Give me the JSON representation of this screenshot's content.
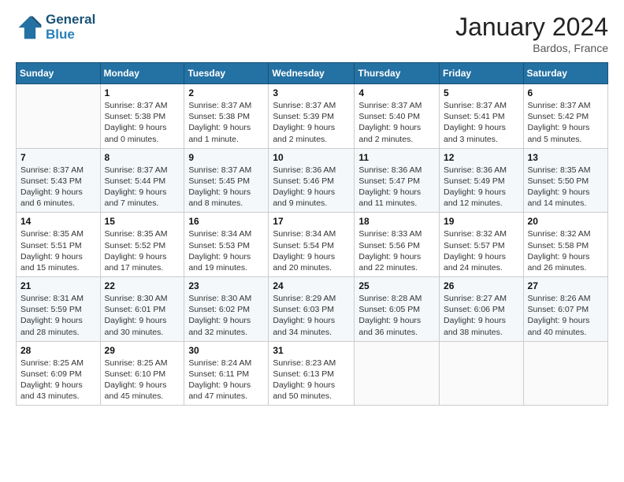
{
  "header": {
    "logo_line1": "General",
    "logo_line2": "Blue",
    "month_title": "January 2024",
    "location": "Bardos, France"
  },
  "weekdays": [
    "Sunday",
    "Monday",
    "Tuesday",
    "Wednesday",
    "Thursday",
    "Friday",
    "Saturday"
  ],
  "weeks": [
    [
      {
        "day": "",
        "sunrise": "",
        "sunset": "",
        "daylight": ""
      },
      {
        "day": "1",
        "sunrise": "Sunrise: 8:37 AM",
        "sunset": "Sunset: 5:38 PM",
        "daylight": "Daylight: 9 hours and 0 minutes."
      },
      {
        "day": "2",
        "sunrise": "Sunrise: 8:37 AM",
        "sunset": "Sunset: 5:38 PM",
        "daylight": "Daylight: 9 hours and 1 minute."
      },
      {
        "day": "3",
        "sunrise": "Sunrise: 8:37 AM",
        "sunset": "Sunset: 5:39 PM",
        "daylight": "Daylight: 9 hours and 2 minutes."
      },
      {
        "day": "4",
        "sunrise": "Sunrise: 8:37 AM",
        "sunset": "Sunset: 5:40 PM",
        "daylight": "Daylight: 9 hours and 2 minutes."
      },
      {
        "day": "5",
        "sunrise": "Sunrise: 8:37 AM",
        "sunset": "Sunset: 5:41 PM",
        "daylight": "Daylight: 9 hours and 3 minutes."
      },
      {
        "day": "6",
        "sunrise": "Sunrise: 8:37 AM",
        "sunset": "Sunset: 5:42 PM",
        "daylight": "Daylight: 9 hours and 5 minutes."
      }
    ],
    [
      {
        "day": "7",
        "sunrise": "Sunrise: 8:37 AM",
        "sunset": "Sunset: 5:43 PM",
        "daylight": "Daylight: 9 hours and 6 minutes."
      },
      {
        "day": "8",
        "sunrise": "Sunrise: 8:37 AM",
        "sunset": "Sunset: 5:44 PM",
        "daylight": "Daylight: 9 hours and 7 minutes."
      },
      {
        "day": "9",
        "sunrise": "Sunrise: 8:37 AM",
        "sunset": "Sunset: 5:45 PM",
        "daylight": "Daylight: 9 hours and 8 minutes."
      },
      {
        "day": "10",
        "sunrise": "Sunrise: 8:36 AM",
        "sunset": "Sunset: 5:46 PM",
        "daylight": "Daylight: 9 hours and 9 minutes."
      },
      {
        "day": "11",
        "sunrise": "Sunrise: 8:36 AM",
        "sunset": "Sunset: 5:47 PM",
        "daylight": "Daylight: 9 hours and 11 minutes."
      },
      {
        "day": "12",
        "sunrise": "Sunrise: 8:36 AM",
        "sunset": "Sunset: 5:49 PM",
        "daylight": "Daylight: 9 hours and 12 minutes."
      },
      {
        "day": "13",
        "sunrise": "Sunrise: 8:35 AM",
        "sunset": "Sunset: 5:50 PM",
        "daylight": "Daylight: 9 hours and 14 minutes."
      }
    ],
    [
      {
        "day": "14",
        "sunrise": "Sunrise: 8:35 AM",
        "sunset": "Sunset: 5:51 PM",
        "daylight": "Daylight: 9 hours and 15 minutes."
      },
      {
        "day": "15",
        "sunrise": "Sunrise: 8:35 AM",
        "sunset": "Sunset: 5:52 PM",
        "daylight": "Daylight: 9 hours and 17 minutes."
      },
      {
        "day": "16",
        "sunrise": "Sunrise: 8:34 AM",
        "sunset": "Sunset: 5:53 PM",
        "daylight": "Daylight: 9 hours and 19 minutes."
      },
      {
        "day": "17",
        "sunrise": "Sunrise: 8:34 AM",
        "sunset": "Sunset: 5:54 PM",
        "daylight": "Daylight: 9 hours and 20 minutes."
      },
      {
        "day": "18",
        "sunrise": "Sunrise: 8:33 AM",
        "sunset": "Sunset: 5:56 PM",
        "daylight": "Daylight: 9 hours and 22 minutes."
      },
      {
        "day": "19",
        "sunrise": "Sunrise: 8:32 AM",
        "sunset": "Sunset: 5:57 PM",
        "daylight": "Daylight: 9 hours and 24 minutes."
      },
      {
        "day": "20",
        "sunrise": "Sunrise: 8:32 AM",
        "sunset": "Sunset: 5:58 PM",
        "daylight": "Daylight: 9 hours and 26 minutes."
      }
    ],
    [
      {
        "day": "21",
        "sunrise": "Sunrise: 8:31 AM",
        "sunset": "Sunset: 5:59 PM",
        "daylight": "Daylight: 9 hours and 28 minutes."
      },
      {
        "day": "22",
        "sunrise": "Sunrise: 8:30 AM",
        "sunset": "Sunset: 6:01 PM",
        "daylight": "Daylight: 9 hours and 30 minutes."
      },
      {
        "day": "23",
        "sunrise": "Sunrise: 8:30 AM",
        "sunset": "Sunset: 6:02 PM",
        "daylight": "Daylight: 9 hours and 32 minutes."
      },
      {
        "day": "24",
        "sunrise": "Sunrise: 8:29 AM",
        "sunset": "Sunset: 6:03 PM",
        "daylight": "Daylight: 9 hours and 34 minutes."
      },
      {
        "day": "25",
        "sunrise": "Sunrise: 8:28 AM",
        "sunset": "Sunset: 6:05 PM",
        "daylight": "Daylight: 9 hours and 36 minutes."
      },
      {
        "day": "26",
        "sunrise": "Sunrise: 8:27 AM",
        "sunset": "Sunset: 6:06 PM",
        "daylight": "Daylight: 9 hours and 38 minutes."
      },
      {
        "day": "27",
        "sunrise": "Sunrise: 8:26 AM",
        "sunset": "Sunset: 6:07 PM",
        "daylight": "Daylight: 9 hours and 40 minutes."
      }
    ],
    [
      {
        "day": "28",
        "sunrise": "Sunrise: 8:25 AM",
        "sunset": "Sunset: 6:09 PM",
        "daylight": "Daylight: 9 hours and 43 minutes."
      },
      {
        "day": "29",
        "sunrise": "Sunrise: 8:25 AM",
        "sunset": "Sunset: 6:10 PM",
        "daylight": "Daylight: 9 hours and 45 minutes."
      },
      {
        "day": "30",
        "sunrise": "Sunrise: 8:24 AM",
        "sunset": "Sunset: 6:11 PM",
        "daylight": "Daylight: 9 hours and 47 minutes."
      },
      {
        "day": "31",
        "sunrise": "Sunrise: 8:23 AM",
        "sunset": "Sunset: 6:13 PM",
        "daylight": "Daylight: 9 hours and 50 minutes."
      },
      {
        "day": "",
        "sunrise": "",
        "sunset": "",
        "daylight": ""
      },
      {
        "day": "",
        "sunrise": "",
        "sunset": "",
        "daylight": ""
      },
      {
        "day": "",
        "sunrise": "",
        "sunset": "",
        "daylight": ""
      }
    ]
  ]
}
